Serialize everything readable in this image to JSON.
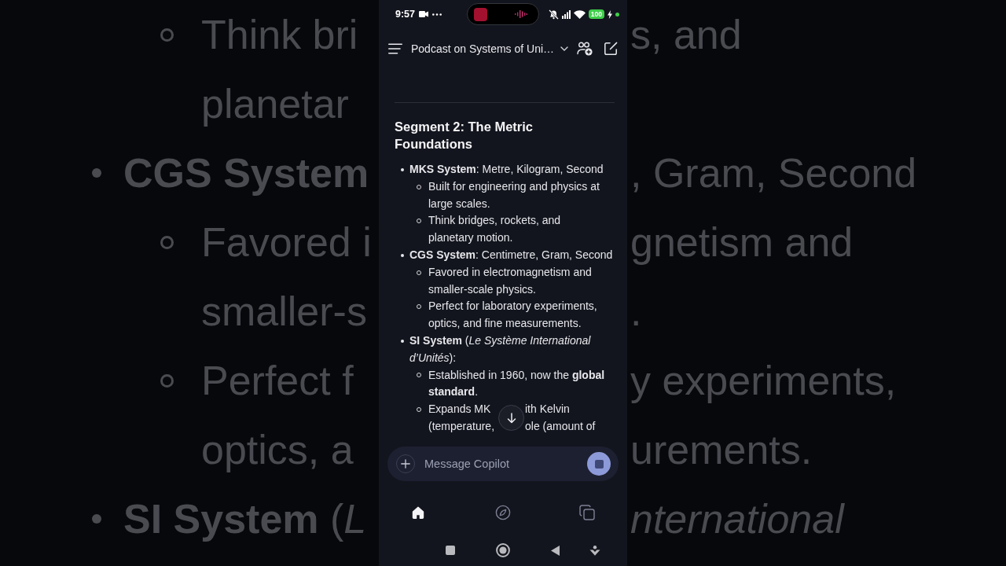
{
  "backdrop": {
    "rows": [
      {
        "kind": "sub",
        "left": {
          "text": "Think bri"
        },
        "right": {
          "text": "s, and"
        }
      },
      {
        "kind": "cont",
        "left": {
          "text": "planetar"
        }
      },
      {
        "kind": "main",
        "left": {
          "text": "CGS System",
          "bold": true
        },
        "right": {
          "text": ", Gram, Second"
        }
      },
      {
        "kind": "sub",
        "left": {
          "text": "Favored i"
        },
        "right": {
          "text": "gnetism and"
        }
      },
      {
        "kind": "cont",
        "left": {
          "text": "smaller-s"
        },
        "right": {
          "text": "."
        }
      },
      {
        "kind": "sub",
        "left": {
          "text": "Perfect f"
        },
        "right": {
          "text": "y experiments,"
        }
      },
      {
        "kind": "cont",
        "left": {
          "text": "optics, a"
        },
        "right": {
          "text": "urements."
        }
      },
      {
        "kind": "main",
        "left": {
          "text": "**SI System** (*L*"
        },
        "right": {
          "text": "nternational",
          "italic": true
        }
      }
    ]
  },
  "status_bar": {
    "time": "9:57",
    "battery": "100"
  },
  "header": {
    "title": "Podcast on Systems of Uni…"
  },
  "message": {
    "heading": "Segment 2: The Metric Foundations",
    "items": [
      {
        "text": "**MKS System**: Metre, Kilogram, Second",
        "children": [
          {
            "kind": "text",
            "text": "Built for engineering and physics at large scales."
          },
          {
            "kind": "text",
            "text": "Think bridges, rockets, and planetary motion."
          }
        ]
      },
      {
        "text": "**CGS System**: Centimetre, Gram, Second",
        "children": [
          {
            "kind": "text",
            "text": "Favored in electromagnetism and smaller-scale physics."
          },
          {
            "kind": "text",
            "text": "Perfect for laboratory experiments, optics, and fine measurements."
          }
        ]
      },
      {
        "text": "**SI System** (*Le Système International d’Unités*):",
        "children": [
          {
            "kind": "text",
            "text": "Established in 1960, now the **global standard**."
          },
          {
            "kind": "covered",
            "lines": [
              {
                "before": "Expands MK",
                "after": "ith Kelvin"
              },
              {
                "before": "(temperature,",
                "after": "ole (amount of"
              }
            ]
          }
        ]
      }
    ]
  },
  "composer": {
    "placeholder": "Message Copilot"
  },
  "bottom_nav": [
    {
      "selected": true
    },
    {
      "selected": false
    },
    {
      "selected": false
    }
  ]
}
